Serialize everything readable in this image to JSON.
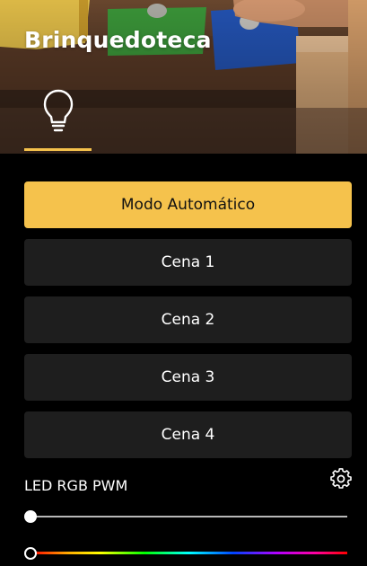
{
  "header": {
    "title": "Brinquedoteca",
    "active_tab_icon": "lightbulb-icon"
  },
  "colors": {
    "accent": "#f5c24c",
    "button_bg": "#1e1e1e",
    "background": "#000000"
  },
  "buttons": [
    {
      "label": "Modo Automático",
      "active": true
    },
    {
      "label": "Cena 1",
      "active": false
    },
    {
      "label": "Cena 2",
      "active": false
    },
    {
      "label": "Cena 3",
      "active": false
    },
    {
      "label": "Cena 4",
      "active": false
    }
  ],
  "led": {
    "label": "LED RGB PWM",
    "settings_icon": "gear-icon",
    "brightness_level": 0,
    "hue_level": 0
  }
}
